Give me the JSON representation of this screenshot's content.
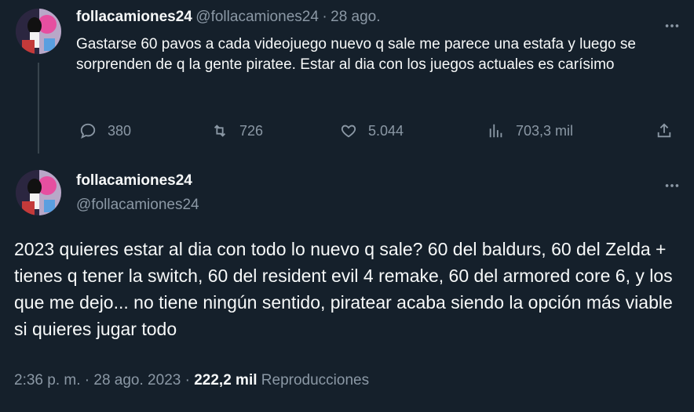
{
  "tweet1": {
    "display_name": "follacamiones24",
    "handle": "@follacamiones24",
    "separator": "·",
    "date": "28 ago.",
    "text": "Gastarse 60 pavos a cada videojuego nuevo q sale me parece una estafa y luego se sorprenden de q la gente piratee. Estar al dia con los juegos actuales es carísimo",
    "replies": "380",
    "retweets": "726",
    "likes": "5.044",
    "views": "703,3 mil"
  },
  "tweet2": {
    "display_name": "follacamiones24",
    "handle": "@follacamiones24",
    "text": "2023 quieres estar al dia con todo lo nuevo q sale? 60 del baldurs, 60 del Zelda + tienes q tener la switch, 60 del resident evil 4 remake, 60 del armored core 6, y los que me dejo... no tiene ningún sentido, piratear acaba siendo la opción más viable si quieres jugar todo",
    "time": "2:36 p. m.",
    "separator": "·",
    "date": "28 ago. 2023",
    "views_count": "222,2 mil",
    "views_label": "Reproducciones"
  },
  "more_label": "···",
  "icons": [
    "reply-icon",
    "retweet-icon",
    "like-icon",
    "views-icon",
    "share-icon",
    "more-icon"
  ],
  "colors": {
    "background": "#15202b",
    "text": "#f7f9f9",
    "muted": "#8b98a5",
    "thread_line": "#38444d"
  }
}
